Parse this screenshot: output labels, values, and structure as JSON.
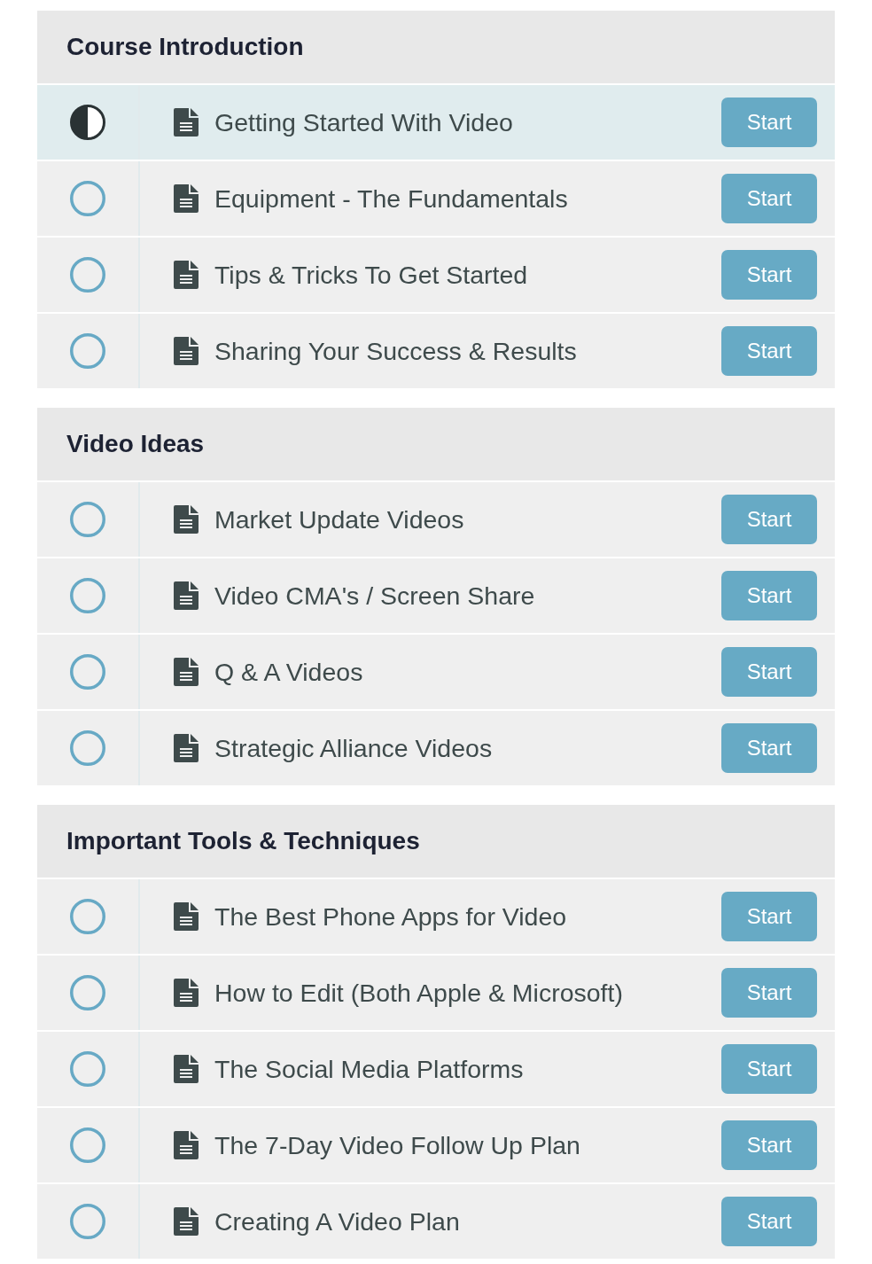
{
  "sections": [
    {
      "title": "Course Introduction",
      "lessons": [
        {
          "title": "Getting Started With Video",
          "in_progress": true,
          "selected": true,
          "button": "Start"
        },
        {
          "title": "Equipment - The Fundamentals",
          "in_progress": false,
          "selected": false,
          "button": "Start"
        },
        {
          "title": "Tips & Tricks To Get Started",
          "in_progress": false,
          "selected": false,
          "button": "Start"
        },
        {
          "title": "Sharing Your Success & Results",
          "in_progress": false,
          "selected": false,
          "button": "Start"
        }
      ]
    },
    {
      "title": "Video Ideas",
      "lessons": [
        {
          "title": "Market Update Videos",
          "in_progress": false,
          "selected": false,
          "button": "Start"
        },
        {
          "title": "Video CMA's / Screen Share",
          "in_progress": false,
          "selected": false,
          "button": "Start"
        },
        {
          "title": "Q & A Videos",
          "in_progress": false,
          "selected": false,
          "button": "Start"
        },
        {
          "title": "Strategic Alliance Videos",
          "in_progress": false,
          "selected": false,
          "button": "Start"
        }
      ]
    },
    {
      "title": "Important Tools & Techniques",
      "lessons": [
        {
          "title": "The Best Phone Apps for Video",
          "in_progress": false,
          "selected": false,
          "button": "Start"
        },
        {
          "title": "How to Edit (Both Apple & Microsoft)",
          "in_progress": false,
          "selected": false,
          "button": "Start"
        },
        {
          "title": "The Social Media Platforms",
          "in_progress": false,
          "selected": false,
          "button": "Start"
        },
        {
          "title": "The 7-Day Video Follow Up Plan",
          "in_progress": false,
          "selected": false,
          "button": "Start"
        },
        {
          "title": "Creating A Video Plan",
          "in_progress": false,
          "selected": false,
          "button": "Start"
        }
      ]
    }
  ]
}
